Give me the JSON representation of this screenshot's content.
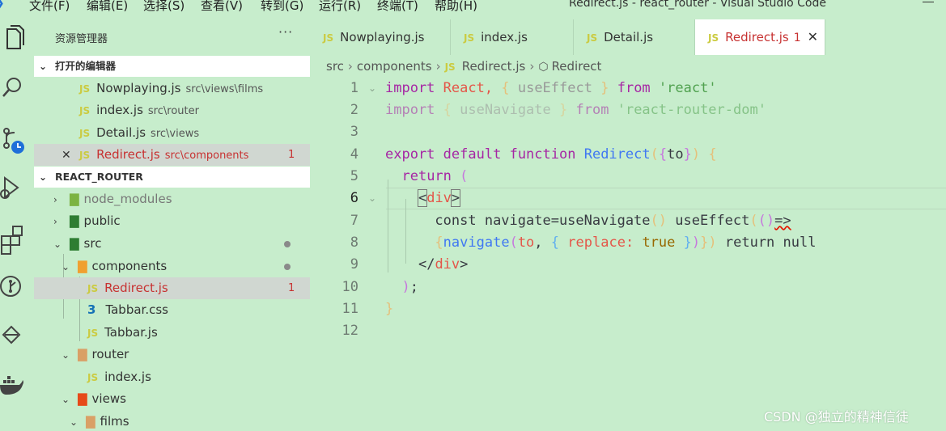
{
  "menu": [
    "文件(F)",
    "编辑(E)",
    "选择(S)",
    "查看(V)",
    "转到(G)",
    "运行(R)",
    "终端(T)",
    "帮助(H)"
  ],
  "window_title": "Redirect.js - react_router - Visual Studio Code",
  "activity_icons": [
    "explorer-icon",
    "search-icon",
    "source-control-icon",
    "run-debug-icon",
    "extensions-icon",
    "git-graph-icon",
    "remote-icon",
    "docker-icon"
  ],
  "sidebar": {
    "title": "资源管理器",
    "more": "···",
    "open_editors": {
      "label": "打开的编辑器",
      "items": [
        {
          "name": "Nowplaying.js",
          "path": "src\\views\\films"
        },
        {
          "name": "index.js",
          "path": "src\\router"
        },
        {
          "name": "Detail.js",
          "path": "src\\views"
        },
        {
          "name": "Redirect.js",
          "path": "src\\components",
          "badge": "1"
        }
      ]
    },
    "project": {
      "label": "REACT_ROUTER",
      "tree": [
        {
          "name": "node_modules"
        },
        {
          "name": "public"
        },
        {
          "name": "src"
        },
        {
          "name": "components"
        },
        {
          "name": "Redirect.js",
          "badge": "1"
        },
        {
          "name": "Tabbar.css"
        },
        {
          "name": "Tabbar.js"
        },
        {
          "name": "router"
        },
        {
          "name": "index.js"
        },
        {
          "name": "views"
        },
        {
          "name": "films"
        }
      ]
    }
  },
  "tabs": [
    {
      "name": "Nowplaying.js"
    },
    {
      "name": "index.js"
    },
    {
      "name": "Detail.js"
    },
    {
      "name": "Redirect.js",
      "badge": "1",
      "close": "✕"
    }
  ],
  "breadcrumb": [
    "src",
    "components",
    "Redirect.js",
    "Redirect"
  ],
  "editor": {
    "line_numbers": [
      "1",
      "2",
      "3",
      "4",
      "5",
      "6",
      "7",
      "8",
      "9",
      "10",
      "11",
      "12"
    ],
    "tokens": {
      "import": "import",
      "react_ident": "React,",
      "lb": "{",
      "rb": "}",
      "useEffect": "useEffect",
      "from": "from",
      "react_str": "'react'",
      "useNavigate": "useNavigate",
      "rrd_str": "'react-router-dom'",
      "export": "export",
      "default": "default",
      "function": "function",
      "fn_name": "Redirect",
      "lp": "(",
      "rp": ")",
      "to": "to",
      "return": "return",
      "div_open_lt": "<",
      "div": "div",
      "div_gt": ">",
      "line7_code": "const navigate=useNavigate",
      "line7_rest": " useEffect",
      "arrow": "=>",
      "navigate": "navigate",
      "comma": ",",
      "replace": "replace:",
      "true": "true",
      "return_null": " return null",
      "div_close": "</",
      "semi": ";"
    }
  },
  "watermark": "CSDN @独立的精神信徒"
}
